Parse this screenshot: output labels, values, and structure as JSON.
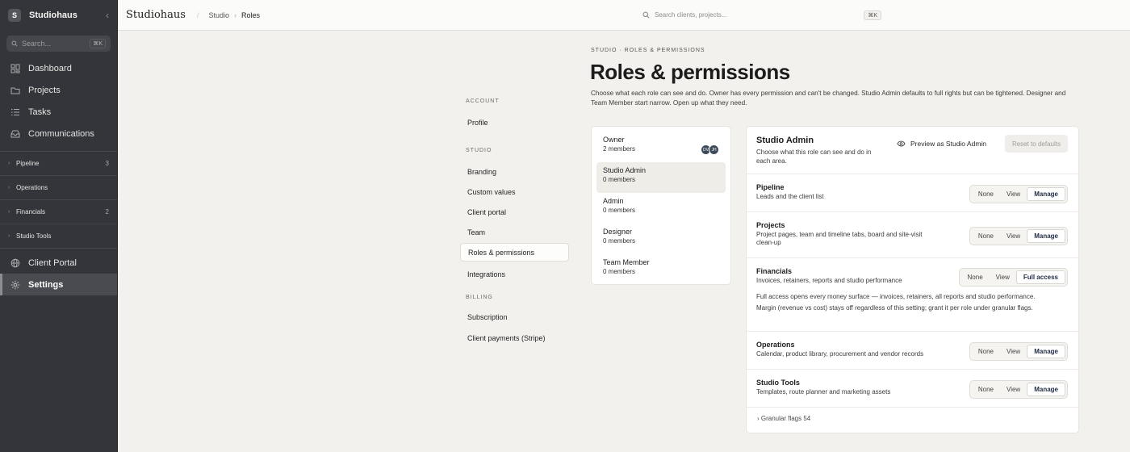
{
  "sidebar": {
    "workspace_initial": "S",
    "workspace_name": "Studiohaus",
    "search_placeholder": "Search...",
    "search_shortcut": "⌘K",
    "main_items": [
      {
        "label": "Dashboard",
        "icon": "dashboard-icon"
      },
      {
        "label": "Projects",
        "icon": "folder-icon"
      },
      {
        "label": "Tasks",
        "icon": "tasks-icon"
      },
      {
        "label": "Communications",
        "icon": "inbox-icon"
      }
    ],
    "groups": [
      {
        "label": "Pipeline",
        "count": "3"
      },
      {
        "label": "Operations",
        "count": ""
      },
      {
        "label": "Financials",
        "count": "2"
      },
      {
        "label": "Studio Tools",
        "count": ""
      }
    ],
    "bottom_items": [
      {
        "label": "Client Portal",
        "icon": "globe-icon"
      },
      {
        "label": "Settings",
        "icon": "gear-icon",
        "active": true
      }
    ]
  },
  "topbar": {
    "brand": "Studiohaus",
    "breadcrumb": [
      "Studio",
      "Roles"
    ],
    "search_placeholder": "Search clients, projects...",
    "search_shortcut": "⌘K"
  },
  "settings_nav": {
    "sections": [
      {
        "title": "ACCOUNT",
        "items": [
          "Profile"
        ]
      },
      {
        "title": "STUDIO",
        "items": [
          "Branding",
          "Custom values",
          "Client portal",
          "Team",
          "Roles & permissions",
          "Integrations"
        ]
      },
      {
        "title": "BILLING",
        "items": [
          "Subscription",
          "Client payments (Stripe)"
        ]
      }
    ],
    "active": "Roles & permissions"
  },
  "header": {
    "eyebrow": "STUDIO · ROLES & PERMISSIONS",
    "title": "Roles & permissions",
    "description": "Choose what each role can see and do. Owner has every permission and can't be changed. Studio Admin defaults to full rights but can be tightened. Designer and Team Member start narrow. Open up what they need."
  },
  "roles": [
    {
      "name": "Owner",
      "members": "2 members",
      "avatars": [
        "DV",
        "JH"
      ]
    },
    {
      "name": "Studio Admin",
      "members": "0 members",
      "active": true
    },
    {
      "name": "Admin",
      "members": "0 members"
    },
    {
      "name": "Designer",
      "members": "0 members"
    },
    {
      "name": "Team Member",
      "members": "0 members"
    }
  ],
  "panel": {
    "title": "Studio Admin",
    "description": "Choose what this role can see and do in each area.",
    "preview_label": "Preview as Studio Admin",
    "reset_label": "Reset to defaults",
    "permissions": [
      {
        "title": "Pipeline",
        "desc": "Leads and the client list",
        "options": [
          "None",
          "View",
          "Manage"
        ],
        "selected": 2
      },
      {
        "title": "Projects",
        "desc": "Project pages, team and timeline tabs, board and site-visit clean-up",
        "options": [
          "None",
          "View",
          "Manage"
        ],
        "selected": 2
      },
      {
        "title": "Financials",
        "desc": "Invoices, retainers, reports and studio performance",
        "options": [
          "None",
          "View",
          "Full access"
        ],
        "selected": 2,
        "note": "Full access opens every money surface — invoices, retainers, all reports and studio performance. Margin (revenue vs cost) stays off regardless of this setting; grant it per role under granular flags."
      },
      {
        "title": "Operations",
        "desc": "Calendar, product library, procurement and vendor records",
        "options": [
          "None",
          "View",
          "Manage"
        ],
        "selected": 2
      },
      {
        "title": "Studio Tools",
        "desc": "Templates, route planner and marketing assets",
        "options": [
          "None",
          "View",
          "Manage"
        ],
        "selected": 2
      }
    ],
    "granular_flags": "› Granular flags 54"
  }
}
